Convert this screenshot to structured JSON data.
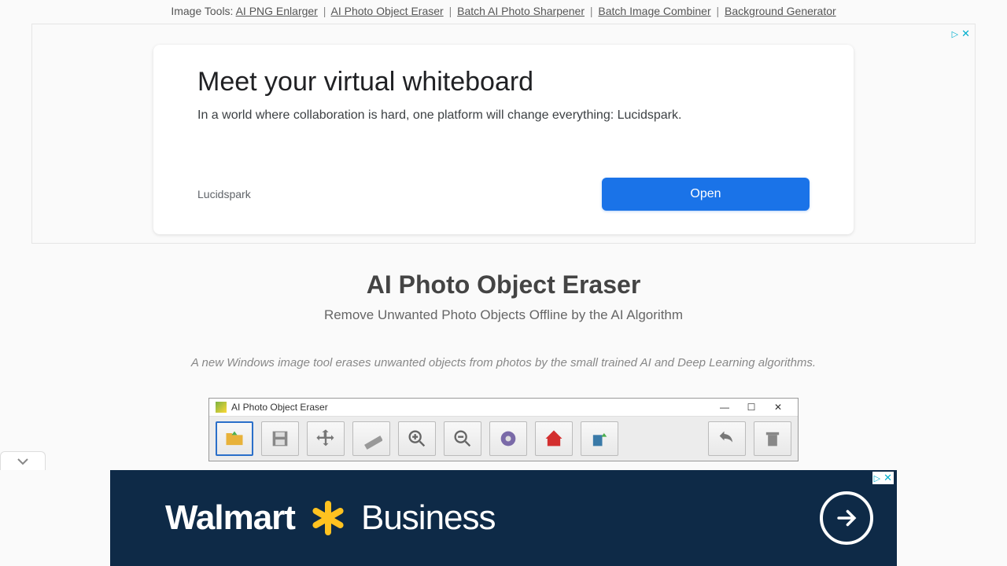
{
  "tools_label": "Image Tools:",
  "tool_links": [
    "AI PNG Enlarger",
    "AI Photo Object Eraser",
    "Batch AI Photo Sharpener",
    "Batch Image Combiner",
    "Background Generator"
  ],
  "top_ad": {
    "headline": "Meet your virtual whiteboard",
    "description": "In a world where collaboration is hard, one platform will change everything: Lucidspark.",
    "brand": "Lucidspark",
    "cta": "Open"
  },
  "page": {
    "title": "AI Photo Object Eraser",
    "subtitle": "Remove Unwanted Photo Objects Offline by the AI Algorithm",
    "tagline": "A new Windows image tool erases unwanted objects from photos by the small trained AI and Deep Learning algorithms."
  },
  "app": {
    "title": "AI Photo Object Eraser"
  },
  "bottom_ad": {
    "text1": "Walmart",
    "text2": "Business"
  }
}
